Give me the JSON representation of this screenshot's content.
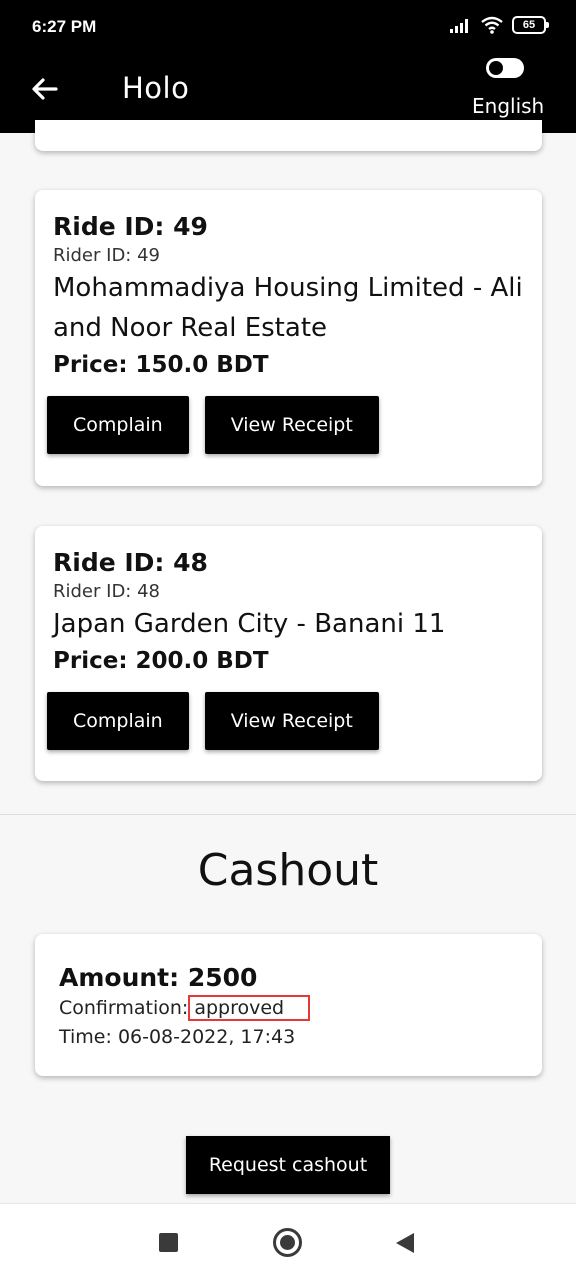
{
  "status_bar": {
    "time": "6:27 PM",
    "battery": "65"
  },
  "app_bar": {
    "title": "Holo",
    "language": "English"
  },
  "rides": [
    {
      "ride_id": "Ride ID: 49",
      "rider_id": "Rider ID: 49",
      "route": "Mohammadiya Housing Limited - Ali and Noor Real Estate",
      "price": "Price: 150.0 BDT",
      "complain_label": "Complain",
      "receipt_label": "View Receipt"
    },
    {
      "ride_id": "Ride ID: 48",
      "rider_id": "Rider ID: 48",
      "route": "Japan Garden City - Banani 11",
      "price": "Price: 200.0 BDT",
      "complain_label": "Complain",
      "receipt_label": "View Receipt"
    }
  ],
  "cashout": {
    "section_title": "Cashout",
    "amount": "Amount: 2500",
    "confirmation_label": "Confirmation:",
    "confirmation_value": "approved",
    "time": "Time: 06-08-2022, 17:43",
    "request_label": "Request cashout"
  },
  "icons": {
    "back": "arrow-left-icon",
    "toggle": "toggle-switch-icon",
    "nav_recents": "square-icon",
    "nav_home": "circle-icon",
    "nav_back": "triangle-back-icon"
  }
}
